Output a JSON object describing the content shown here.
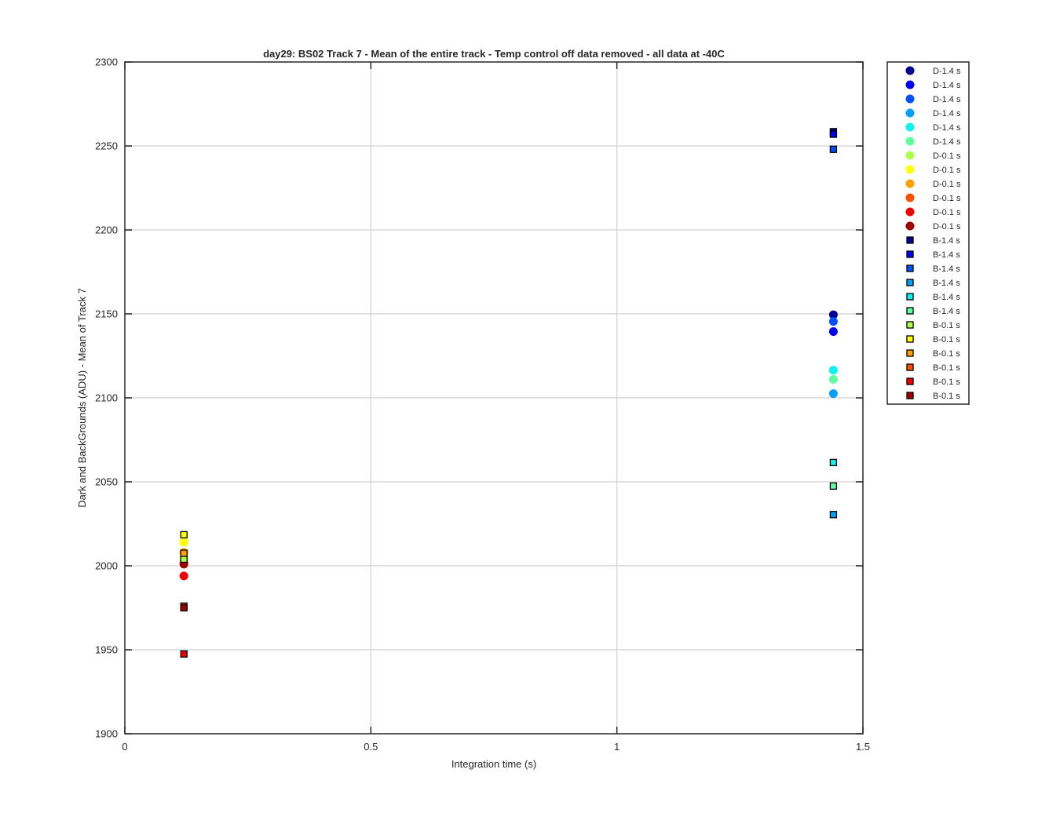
{
  "chart_data": {
    "type": "scatter",
    "title": "day29: BS02  Track 7 - Mean of the entire track - Temp control off data removed - all data at -40C",
    "xlabel": "Integration time (s)",
    "ylabel": "Dark and BackGrounds (ADU) - Mean of Track 7",
    "xlim": [
      0,
      1.5
    ],
    "ylim": [
      1900,
      2300
    ],
    "xticks": [
      "0",
      "0.5",
      "1",
      "1.5"
    ],
    "yticks": [
      "1900",
      "1950",
      "2000",
      "2050",
      "2100",
      "2150",
      "2200",
      "2250",
      "2300"
    ],
    "grid": true,
    "legend_position": "outside-top-right",
    "series": [
      {
        "name": "D-1.4 s",
        "marker": "circle",
        "color": "#00008f",
        "points": [
          [
            1.44,
            2149.5
          ]
        ]
      },
      {
        "name": "D-1.4 s",
        "marker": "circle",
        "color": "#0000f0",
        "points": [
          [
            1.44,
            2139.5
          ]
        ]
      },
      {
        "name": "D-1.4 s",
        "marker": "circle",
        "color": "#0050ff",
        "points": [
          [
            1.44,
            2145.5
          ]
        ]
      },
      {
        "name": "D-1.4 s",
        "marker": "circle",
        "color": "#00a0ff",
        "points": [
          [
            1.44,
            2102.5
          ]
        ]
      },
      {
        "name": "D-1.4 s",
        "marker": "circle",
        "color": "#10f0ef",
        "points": [
          [
            1.44,
            2116.5
          ]
        ]
      },
      {
        "name": "D-1.4 s",
        "marker": "circle",
        "color": "#5fff9f",
        "points": [
          [
            1.44,
            2111
          ]
        ]
      },
      {
        "name": "D-0.1 s",
        "marker": "circle",
        "color": "#afff50",
        "points": [
          [
            0.12,
            2005
          ]
        ]
      },
      {
        "name": "D-0.1 s",
        "marker": "circle",
        "color": "#ffff00",
        "points": [
          [
            0.12,
            2014
          ]
        ]
      },
      {
        "name": "D-0.1 s",
        "marker": "circle",
        "color": "#ffa000",
        "points": [
          [
            0.12,
            2008
          ]
        ]
      },
      {
        "name": "D-0.1 s",
        "marker": "circle",
        "color": "#ff5000",
        "points": [
          [
            0.12,
            2002
          ]
        ]
      },
      {
        "name": "D-0.1 s",
        "marker": "circle",
        "color": "#f00000",
        "points": [
          [
            0.12,
            1994
          ]
        ]
      },
      {
        "name": "D-0.1 s",
        "marker": "circle",
        "color": "#9f0000",
        "points": [
          [
            0.12,
            2001
          ]
        ]
      },
      {
        "name": "B-1.4 s",
        "marker": "square",
        "color": "#00008f",
        "points": [
          [
            1.44,
            2258.5
          ]
        ]
      },
      {
        "name": "B-1.4 s",
        "marker": "square",
        "color": "#0000f0",
        "points": [
          [
            1.44,
            2257
          ]
        ]
      },
      {
        "name": "B-1.4 s",
        "marker": "square",
        "color": "#0050ff",
        "points": [
          [
            1.44,
            2248
          ]
        ]
      },
      {
        "name": "B-1.4 s",
        "marker": "square",
        "color": "#00a0ff",
        "points": [
          [
            1.44,
            2030.5
          ]
        ]
      },
      {
        "name": "B-1.4 s",
        "marker": "square",
        "color": "#10f0ef",
        "points": [
          [
            1.44,
            2061.5
          ]
        ]
      },
      {
        "name": "B-1.4 s",
        "marker": "square",
        "color": "#5fff9f",
        "points": [
          [
            1.44,
            2047.5
          ]
        ]
      },
      {
        "name": "B-0.1 s",
        "marker": "square",
        "color": "#afff50",
        "points": [
          [
            0.12,
            2004
          ]
        ]
      },
      {
        "name": "B-0.1 s",
        "marker": "square",
        "color": "#ffff00",
        "points": [
          [
            0.12,
            2018.5
          ]
        ]
      },
      {
        "name": "B-0.1 s",
        "marker": "square",
        "color": "#ffa000",
        "points": [
          [
            0.12,
            2007.5
          ]
        ]
      },
      {
        "name": "B-0.1 s",
        "marker": "square",
        "color": "#ff5000",
        "points": [
          [
            0.12,
            1976
          ]
        ]
      },
      {
        "name": "B-0.1 s",
        "marker": "square",
        "color": "#f00000",
        "points": [
          [
            0.12,
            1947.5
          ]
        ]
      },
      {
        "name": "B-0.1 s",
        "marker": "square",
        "color": "#9f0000",
        "points": [
          [
            0.12,
            1975
          ]
        ]
      }
    ]
  }
}
